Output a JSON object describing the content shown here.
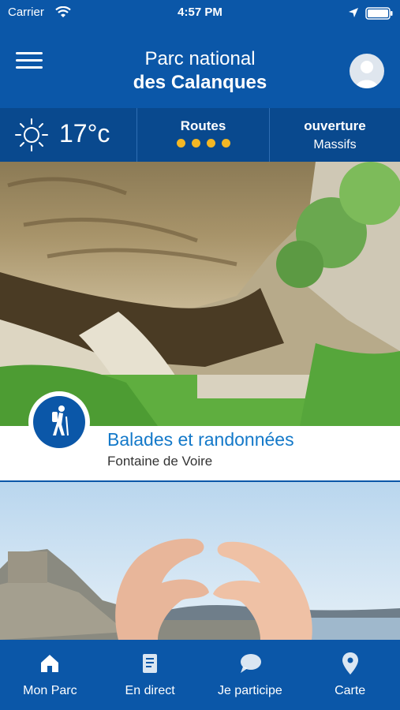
{
  "status_bar": {
    "carrier": "Carrier",
    "time": "4:57 PM"
  },
  "header": {
    "title_line1": "Parc national",
    "title_line2": "des Calanques"
  },
  "info": {
    "weather": {
      "temp": "17°c",
      "icon": "sun-icon"
    },
    "routes": {
      "label": "Routes",
      "rating": 4
    },
    "opening": {
      "label": "ouverture",
      "value": "Massifs"
    }
  },
  "card": {
    "title": "Balades et randonnées",
    "subtitle": "Fontaine de Voire",
    "icon": "hiker-icon"
  },
  "tabs": [
    {
      "label": "Mon Parc",
      "icon": "home-icon"
    },
    {
      "label": "En direct",
      "icon": "news-icon"
    },
    {
      "label": "Je participe",
      "icon": "chat-icon"
    },
    {
      "label": "Carte",
      "icon": "map-pin-icon"
    }
  ],
  "colors": {
    "primary": "#0b57a8",
    "dark": "#09498e",
    "accent": "#f3b724",
    "link": "#1479c9"
  }
}
